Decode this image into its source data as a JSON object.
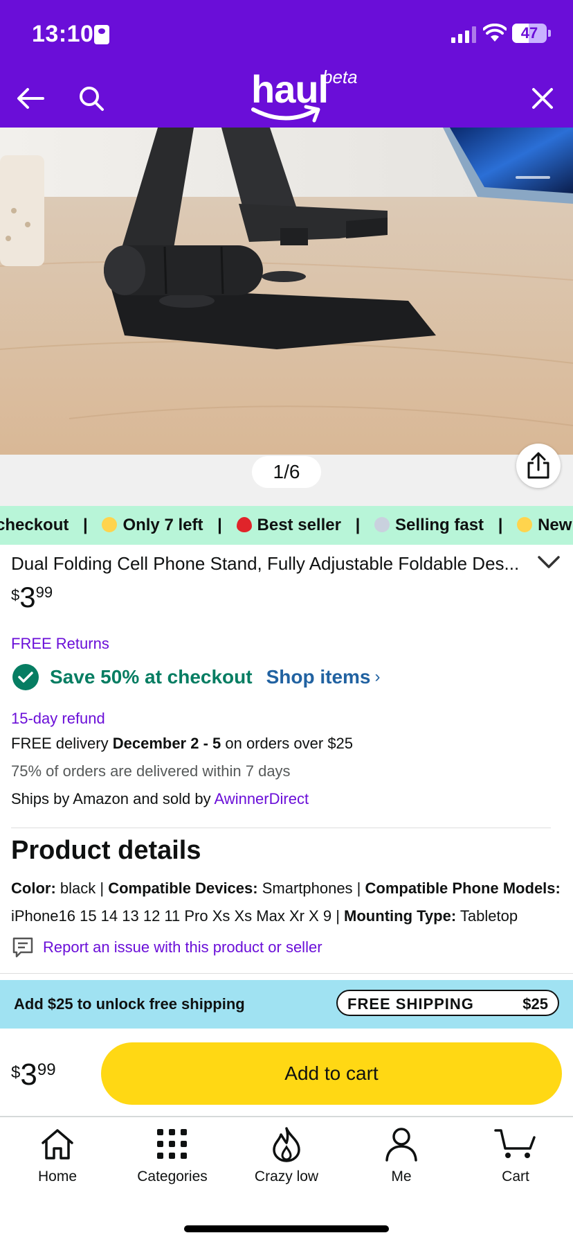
{
  "status_bar": {
    "time": "13:10",
    "battery": "47",
    "battery_level": 0.47
  },
  "header": {
    "logo": "haul",
    "logo_badge": "beta"
  },
  "gallery": {
    "counter": "1/6"
  },
  "ticker": {
    "items": [
      "checkout",
      "Only 7 left",
      "Best seller",
      "Selling fast",
      "New in"
    ],
    "separator": "|"
  },
  "product": {
    "title": "Dual Folding Cell Phone Stand, Fully Adjustable Foldable Des...",
    "price": {
      "currency": "$",
      "whole": "3",
      "fraction": "99"
    },
    "free_returns": "FREE Returns",
    "promo": {
      "text": "Save 50% at checkout",
      "link": "Shop items",
      "arrow": "›"
    },
    "refund": "15-day refund",
    "delivery": {
      "prefix": "FREE delivery ",
      "dates": "December 2 - 5",
      "suffix": " on orders over $25"
    },
    "delivery_stat": "75% of orders are delivered within 7 days",
    "ships": {
      "prefix": "Ships by Amazon and sold by ",
      "seller": "AwinnerDirect"
    }
  },
  "details": {
    "title": "Product details",
    "color_label": "Color:",
    "color_value": " black | ",
    "devices_label": "Compatible Devices:",
    "devices_value": " Smartphones | ",
    "models_label": "Compatible Phone Models:",
    "models_value": " iPhone16 15 14 13 12 11 Pro Xs Xs Max Xr X 9 | ",
    "mounting_label": "Mounting Type:",
    "mounting_value": " Tabletop",
    "report": "Report an issue with this product or seller"
  },
  "shipping_banner": {
    "message": "Add $25 to unlock free shipping",
    "pill_label": "FREE SHIPPING",
    "pill_amount": "$25"
  },
  "buy_bar": {
    "currency": "$",
    "whole": "3",
    "fraction": "99",
    "button": "Add to cart"
  },
  "tabs": [
    {
      "label": "Home",
      "icon": "home-icon"
    },
    {
      "label": "Categories",
      "icon": "grid-icon"
    },
    {
      "label": "Crazy low",
      "icon": "flame-icon"
    },
    {
      "label": "Me",
      "icon": "person-icon"
    },
    {
      "label": "Cart",
      "icon": "cart-icon"
    }
  ],
  "colors": {
    "brand_purple": "#6a0ed8",
    "ticker_green": "#b8f5d8",
    "promo_green": "#067d62",
    "link_blue": "#2162a1",
    "banner_cyan": "#a0e2f2",
    "cart_yellow": "#ffd814"
  }
}
